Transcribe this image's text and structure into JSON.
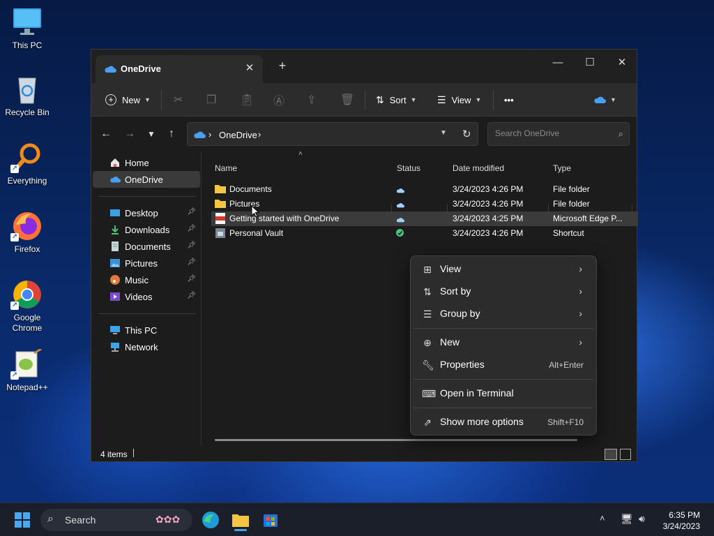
{
  "desktop": {
    "icons": [
      {
        "label": "This PC"
      },
      {
        "label": "Recycle Bin"
      },
      {
        "label": "Everything"
      },
      {
        "label": "Firefox"
      },
      {
        "label": "Google Chrome"
      },
      {
        "label": "Notepad++"
      }
    ]
  },
  "window": {
    "tab_title": "OneDrive",
    "toolbar": {
      "new_label": "New",
      "sort_label": "Sort",
      "view_label": "View",
      "more_label": "•••"
    },
    "address": {
      "path": "OneDrive",
      "separator": "›"
    },
    "search": {
      "placeholder": "Search OneDrive"
    },
    "sidebar": {
      "home": "Home",
      "onedrive": "OneDrive",
      "quick": [
        "Desktop",
        "Downloads",
        "Documents",
        "Pictures",
        "Music",
        "Videos"
      ],
      "this_pc": "This PC",
      "network": "Network"
    },
    "columns": {
      "name": "Name",
      "status": "Status",
      "date": "Date modified",
      "type": "Type"
    },
    "files": [
      {
        "name": "Documents",
        "date": "3/24/2023 4:26 PM",
        "type": "File folder"
      },
      {
        "name": "Pictures",
        "date": "3/24/2023 4:26 PM",
        "type": "File folder"
      },
      {
        "name": "Getting started with OneDrive",
        "date": "3/24/2023 4:25 PM",
        "type": "Microsoft Edge P..."
      },
      {
        "name": "Personal Vault",
        "date": "3/24/2023 4:26 PM",
        "type": "Shortcut"
      }
    ],
    "status_text": "4 items"
  },
  "context_menu": {
    "items": [
      {
        "label": "View"
      },
      {
        "label": "Sort by"
      },
      {
        "label": "Group by"
      },
      {
        "label": "New"
      },
      {
        "label": "Properties",
        "shortcut": "Alt+Enter"
      },
      {
        "label": "Open in Terminal"
      },
      {
        "label": "Show more options",
        "shortcut": "Shift+F10"
      }
    ]
  },
  "taskbar": {
    "search_label": "Search",
    "time": "6:35 PM",
    "date": "3/24/2023"
  },
  "colors": {
    "accent": "#4aa0f0",
    "folder": "#f4c542",
    "window_bg": "#1c1c1c",
    "selected": "#3a3a3a"
  }
}
